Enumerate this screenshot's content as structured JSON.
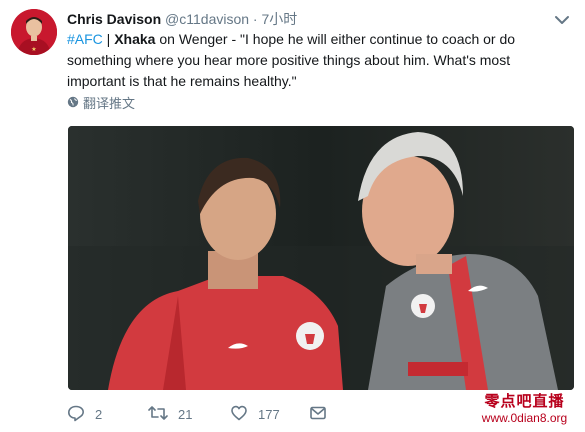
{
  "tweet": {
    "author_name": "Chris Davison",
    "handle": "@c11davison",
    "separator": "·",
    "time": "7小时",
    "text_parts": {
      "hashtag": "#AFC",
      "pipe": " | ",
      "bold_name": "Xhaka",
      "rest": " on Wenger - \"I hope he will either continue to coach or do something where you hear more positive things about him. What's most important is that he remains healthy.\""
    },
    "translate_label": "翻译推文"
  },
  "actions": {
    "reply_count": "2",
    "retweet_count": "21",
    "like_count": "177"
  },
  "watermark": {
    "line1": "零点吧直播",
    "line2": "www.0dian8.org"
  },
  "colors": {
    "link": "#1b95e0",
    "meta": "#657786",
    "watermark": "#b8001c"
  },
  "icons": [
    "chevron-down-icon",
    "globe-icon",
    "reply-icon",
    "retweet-icon",
    "like-icon",
    "message-icon"
  ]
}
